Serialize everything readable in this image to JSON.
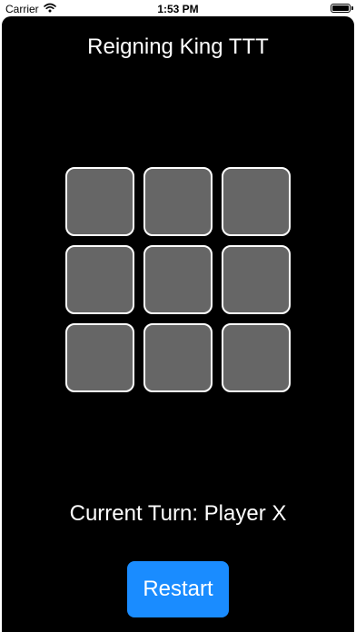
{
  "status_bar": {
    "carrier": "Carrier",
    "time": "1:53 PM",
    "battery_level": 1.0,
    "icons": [
      "wifi-icon",
      "battery-icon"
    ]
  },
  "app": {
    "title": "Reigning King TTT",
    "board": {
      "cells": [
        "",
        "",
        "",
        "",
        "",
        "",
        "",
        "",
        ""
      ],
      "cell_color": "#666666",
      "cell_border_color": "#ffffff"
    },
    "turn_text": "Current Turn: Player X",
    "restart_label": "Restart",
    "accent_color": "#1a8cff",
    "background_color": "#000000"
  }
}
